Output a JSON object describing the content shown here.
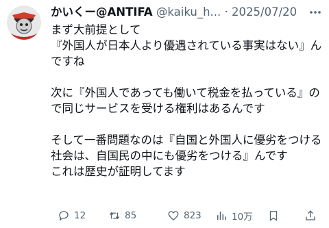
{
  "tweet": {
    "display_name": "かいくー@ANTIFA",
    "handle": "@kaiku_h...",
    "separator": "·",
    "date": "2025/07/20",
    "more_icon": "more-dots-icon",
    "paragraphs": [
      "まず大前提として\n『外国人が日本人より優遇されている事実はない』んですね",
      "次に『外国人であっても働いて税金を払っている』ので同じサービスを受ける権利はあるんです",
      "そして一番問題なのは『自国と外国人に優劣をつける社会は、自国民の中にも優劣をつける』んです\nこれは歴史が証明してます"
    ]
  },
  "actions": {
    "reply": {
      "icon": "reply-icon",
      "count": "12"
    },
    "retweet": {
      "icon": "retweet-icon",
      "count": "85"
    },
    "like": {
      "icon": "heart-icon",
      "count": "823"
    },
    "views": {
      "icon": "views-icon",
      "count": "10万"
    },
    "bookmark": {
      "icon": "bookmark-icon"
    },
    "share": {
      "icon": "share-icon"
    }
  },
  "colors": {
    "text": "#0f1419",
    "muted": "#536471",
    "avatar_accent": "#d93a2b"
  }
}
